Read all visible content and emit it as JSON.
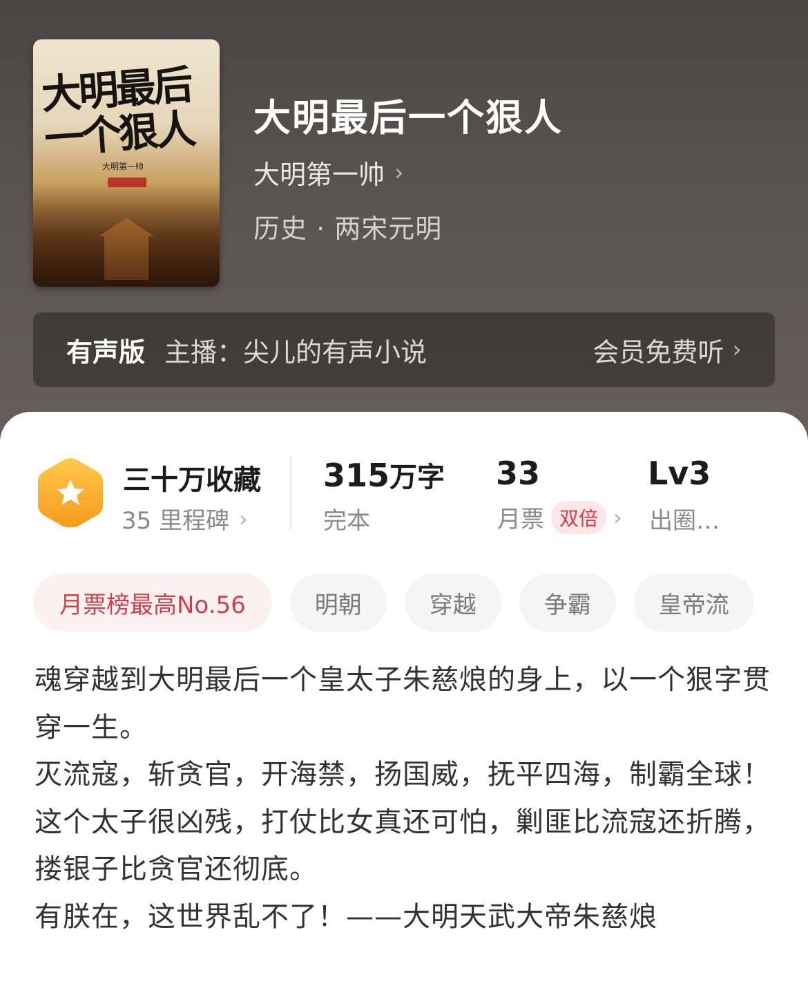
{
  "book": {
    "cover_title": "大明最后一个狠人",
    "cover_author": "大明第一帅",
    "title": "大明最后一个狠人",
    "author": "大明第一帅",
    "genre": "历史 · 两宋元明"
  },
  "audio": {
    "label": "有声版",
    "host": "主播：尖儿的有声小说",
    "vip": "会员免费听"
  },
  "stats": {
    "favorites": "三十万收藏",
    "milestones": "35 里程碑",
    "word_count": "315",
    "word_unit": "万字",
    "status": "完本",
    "monthly_votes": "33",
    "monthly_votes_label": "月票",
    "double_tag": "双倍",
    "level": "Lv3",
    "level_label": "出圈…"
  },
  "tags": [
    "月票榜最高No.56",
    "明朝",
    "穿越",
    "争霸",
    "皇帝流"
  ],
  "description": [
    "魂穿越到大明最后一个皇太子朱慈烺的身上，以一个狠字贯穿一生。",
    "灭流寇，斩贪官，开海禁，扬国威，抚平四海，制霸全球！",
    "这个太子很凶残，打仗比女真还可怕，剿匪比流寇还折腾，搂银子比贪官还彻底。",
    "有朕在，这世界乱不了！——大明天武大帝朱慈烺"
  ],
  "colors": {
    "header_bg": "#5a5452",
    "accent_red": "#d0404a",
    "badge_orange": "#f5a623"
  }
}
